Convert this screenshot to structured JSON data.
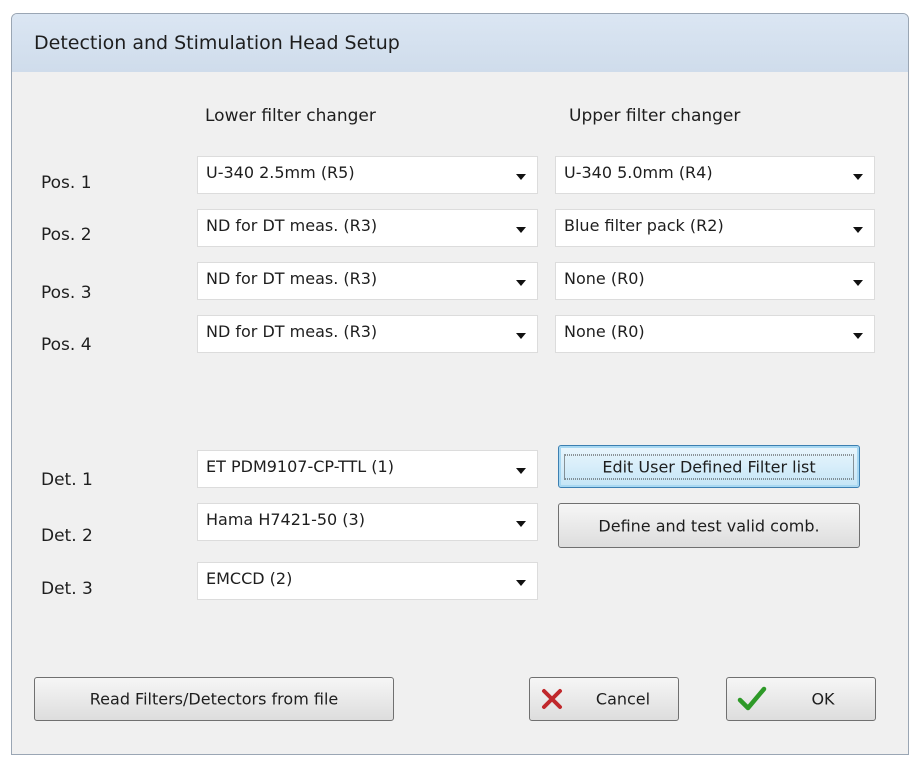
{
  "window": {
    "title": "Detection and Stimulation Head Setup"
  },
  "headers": {
    "lower": "Lower filter changer",
    "upper": "Upper filter changer"
  },
  "positions": [
    {
      "label": "Pos. 1",
      "lower": "U-340 2.5mm (R5)",
      "upper": "U-340 5.0mm (R4)"
    },
    {
      "label": "Pos. 2",
      "lower": "ND for DT meas. (R3)",
      "upper": "Blue filter pack (R2)"
    },
    {
      "label": "Pos. 3",
      "lower": "ND for DT meas. (R3)",
      "upper": "None (R0)"
    },
    {
      "label": "Pos. 4",
      "lower": "ND for DT meas. (R3)",
      "upper": "None (R0)"
    }
  ],
  "detectors": [
    {
      "label": "Det. 1",
      "value": "ET PDM9107-CP-TTL (1)"
    },
    {
      "label": "Det. 2",
      "value": "Hama H7421-50 (3)"
    },
    {
      "label": "Det. 3",
      "value": "EMCCD (2)"
    }
  ],
  "buttons": {
    "edit_filter_list": "Edit User Defined Filter list",
    "define_test": "Define and test valid comb.",
    "read_file": "Read Filters/Detectors from file",
    "cancel": "Cancel",
    "ok": "OK"
  },
  "icons": {
    "cancel": "x-icon",
    "ok": "checkmark-icon"
  },
  "colors": {
    "cancel_x": "#c0282c",
    "ok_check": "#2e9a28",
    "focus_border": "#3c7fb1"
  }
}
